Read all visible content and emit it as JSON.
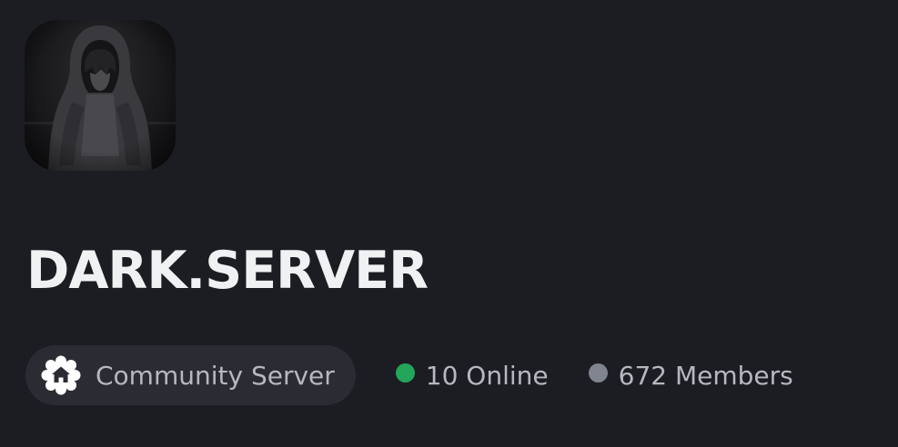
{
  "server": {
    "name": "DARK.SERVER",
    "icon": "hooded-figure-avatar"
  },
  "badge": {
    "icon": "community-home-badge-icon",
    "label": "Community Server"
  },
  "stats": {
    "online": "10 Online",
    "members": "672 Members"
  },
  "colors": {
    "background": "#1c1d22",
    "pill_background": "#2b2c33",
    "online_dot": "#23a55a",
    "members_dot": "#80848e",
    "title_text": "#f0f1f3",
    "secondary_text": "#b5b8bf"
  }
}
